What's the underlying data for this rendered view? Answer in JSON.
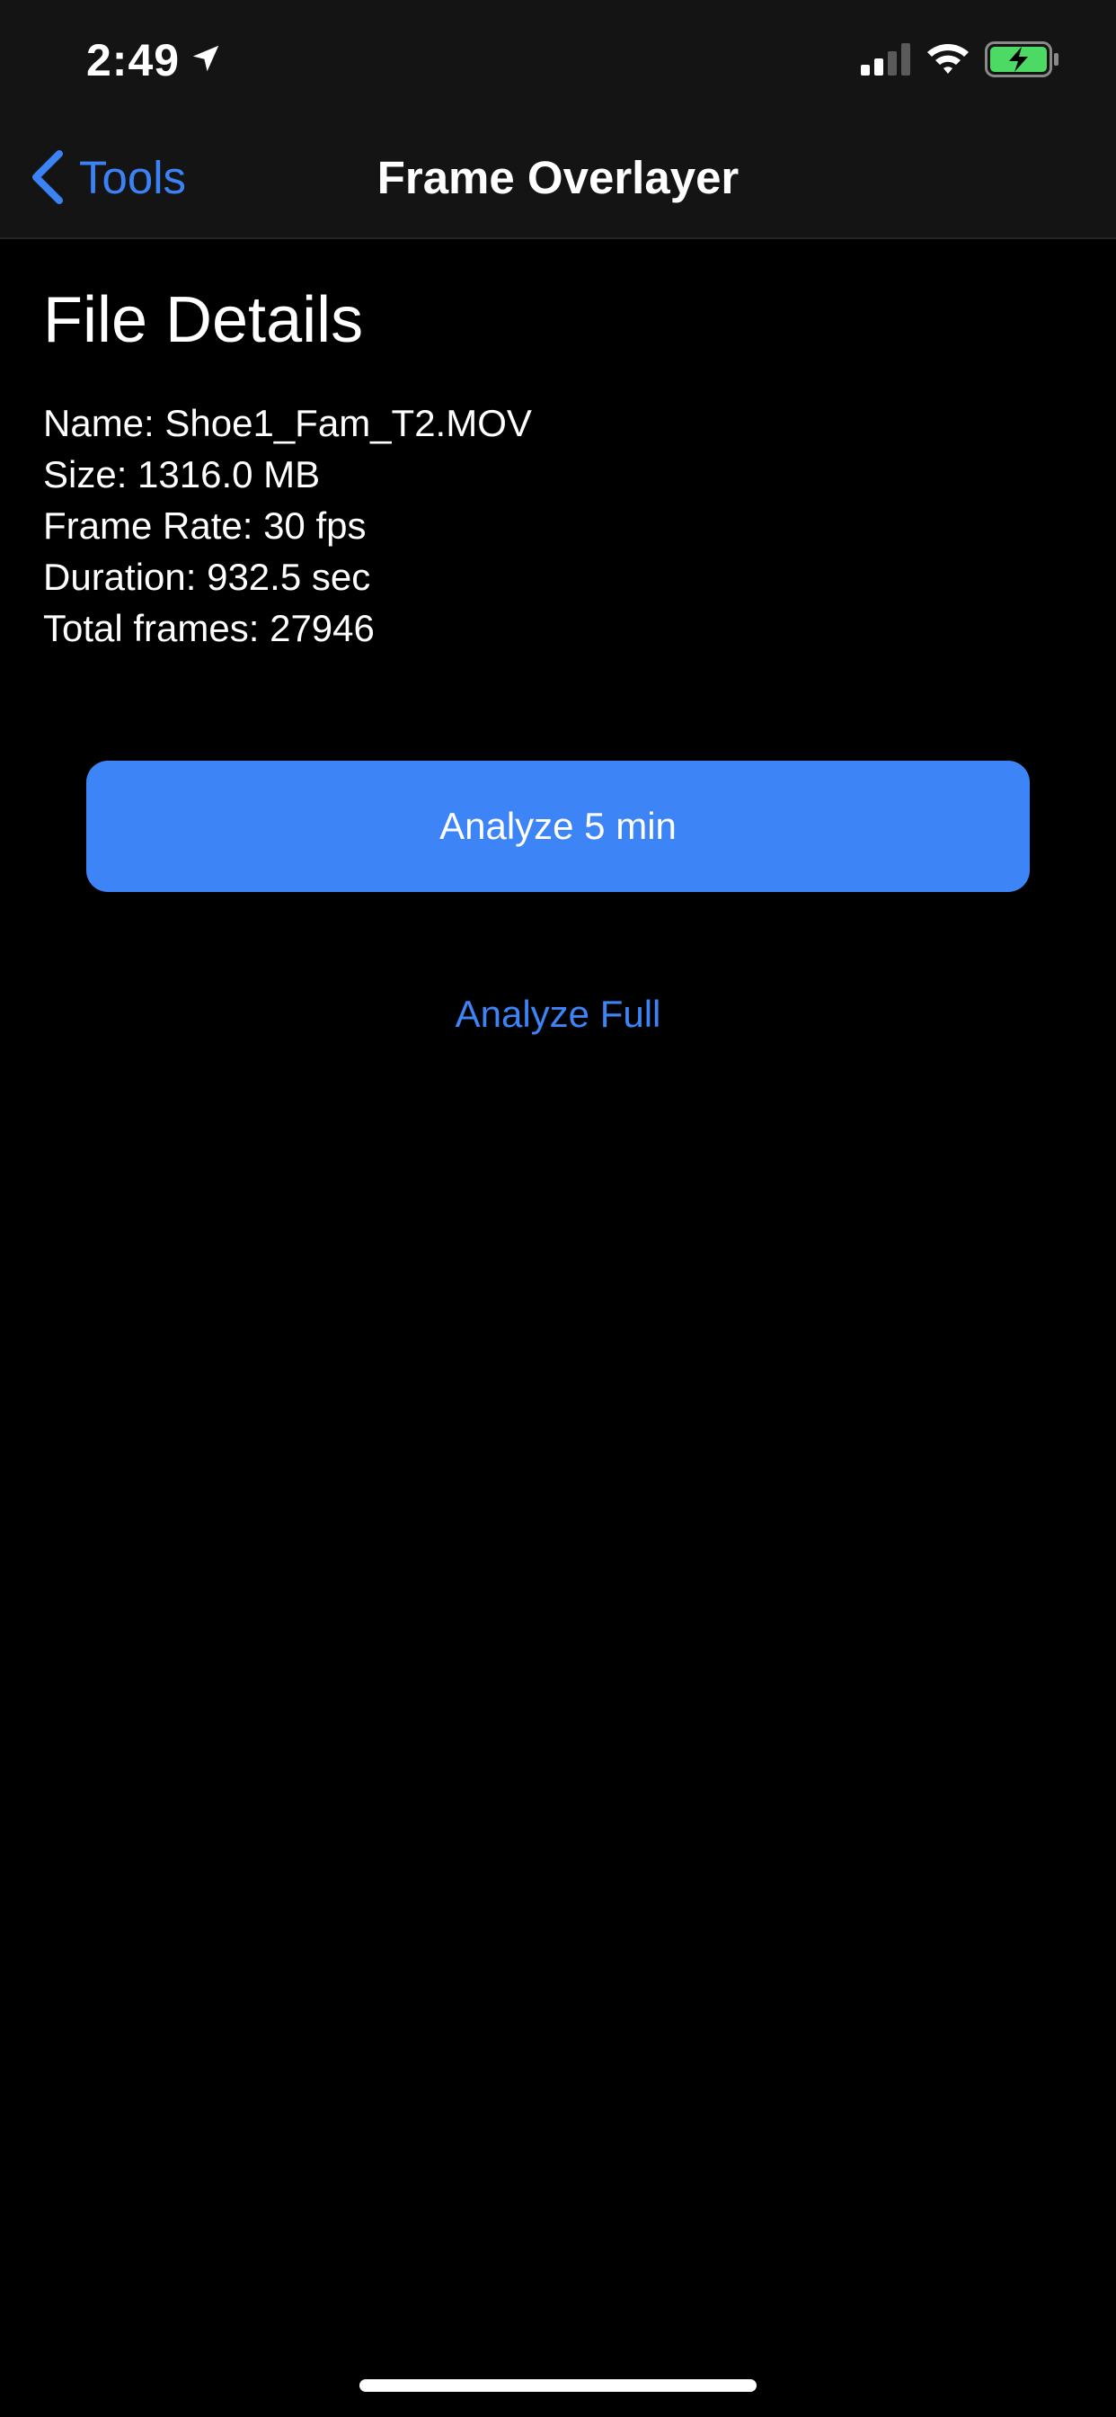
{
  "status_bar": {
    "time": "2:49",
    "icons": [
      "location-arrow-icon",
      "cellular-signal-icon",
      "wifi-icon",
      "battery-charging-icon"
    ],
    "battery_color": "#4cd964"
  },
  "nav": {
    "back_label": "Tools",
    "title": "Frame Overlayer",
    "accent_color": "#3b82f6"
  },
  "file_details": {
    "heading": "File Details",
    "lines": [
      "Name: Shoe1_Fam_T2.MOV",
      "Size: 1316.0 MB",
      "Frame Rate: 30 fps",
      "Duration: 932.5 sec",
      "Total frames: 27946"
    ]
  },
  "actions": {
    "primary_label": "Analyze 5 min",
    "secondary_label": "Analyze Full",
    "primary_color": "#3d84f6"
  }
}
